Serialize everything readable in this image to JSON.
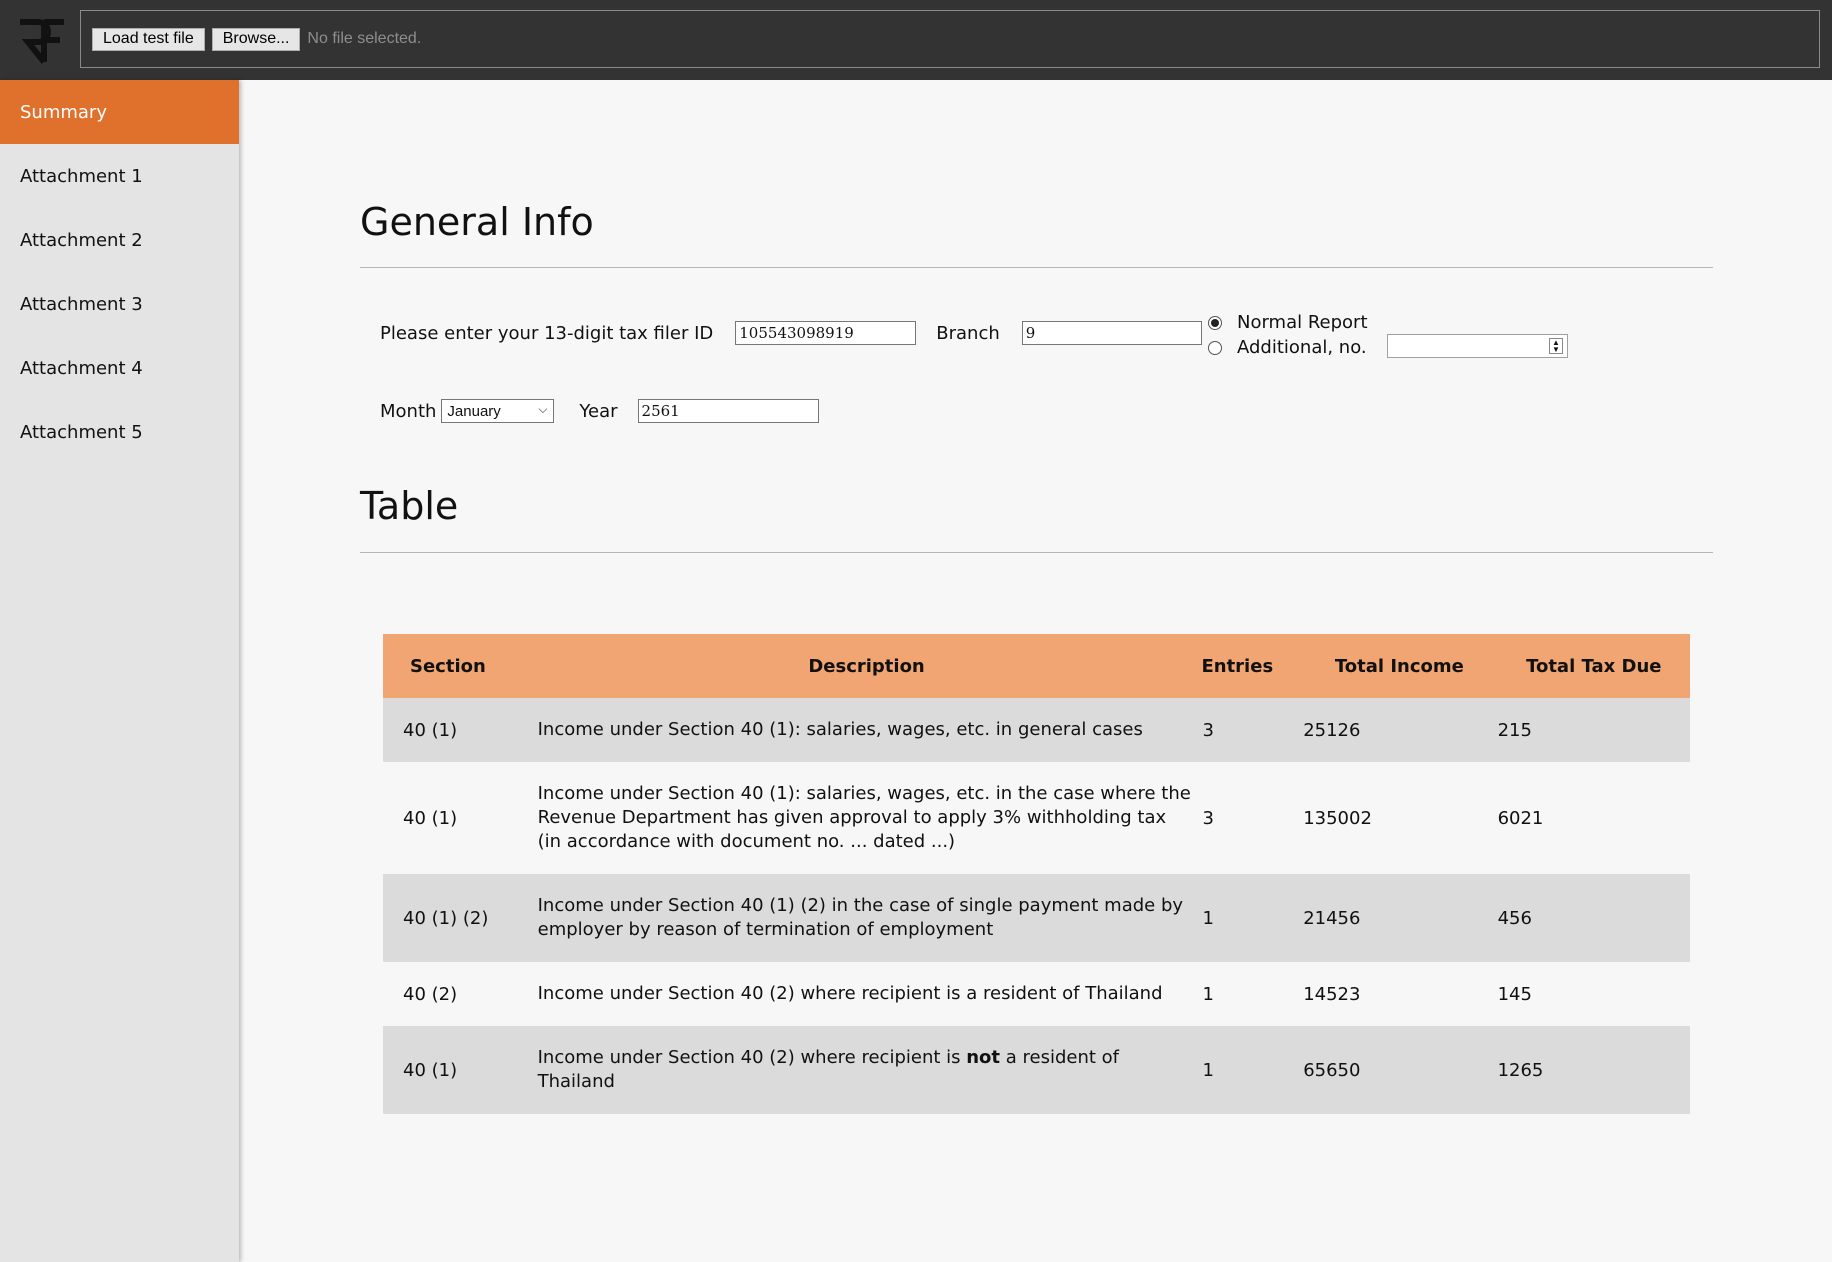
{
  "toolbar": {
    "load_test_label": "Load test file",
    "browse_label": "Browse...",
    "file_status": "No file selected."
  },
  "sidebar": {
    "items": [
      {
        "label": "Summary",
        "active": true
      },
      {
        "label": "Attachment 1"
      },
      {
        "label": "Attachment 2"
      },
      {
        "label": "Attachment 3"
      },
      {
        "label": "Attachment 4"
      },
      {
        "label": "Attachment 5"
      }
    ]
  },
  "general_info": {
    "title": "General Info",
    "tax_id_label": "Please enter your 13-digit tax filer ID",
    "tax_id_value": "105543098919",
    "branch_label": "Branch",
    "branch_value": "9",
    "normal_report_label": "Normal Report",
    "additional_label": "Additional, no.",
    "additional_value": "",
    "month_label": "Month",
    "month_value": "January",
    "year_label": "Year",
    "year_value": "2561"
  },
  "table": {
    "title": "Table",
    "headers": [
      "Section",
      "Description",
      "Entries",
      "Total Income",
      "Total Tax Due"
    ],
    "rows": [
      {
        "section": "40 (1)",
        "desc_lines": [
          "Income under Section 40 (1): salaries, wages, etc. in general cases"
        ],
        "entries": "3",
        "income": "25126",
        "tax": "215"
      },
      {
        "section": "40 (1)",
        "desc_lines": [
          "Income under Section 40 (1): salaries, wages, etc. in the case where the",
          "Revenue Department has given approval to apply 3% withholding tax",
          "(in accordance with document no. ... dated ...)"
        ],
        "entries": "3",
        "income": "135002",
        "tax": "6021"
      },
      {
        "section": "40 (1) (2)",
        "desc_lines": [
          "Income under Section 40 (1) (2) in the case of single payment made by",
          "employer by reason of termination of employment"
        ],
        "entries": "1",
        "income": "21456",
        "tax": "456"
      },
      {
        "section": "40 (2)",
        "desc_lines": [
          "Income under Section 40 (2) where recipient is a resident of Thailand"
        ],
        "entries": "1",
        "income": "14523",
        "tax": "145"
      },
      {
        "section": "40 (1)",
        "desc_pre": "Income under Section 40 (2) where recipient is ",
        "desc_bold": "not",
        "desc_post": " a resident of",
        "desc_line2": "Thailand",
        "entries": "1",
        "income": "65650",
        "tax": "1265"
      }
    ]
  }
}
